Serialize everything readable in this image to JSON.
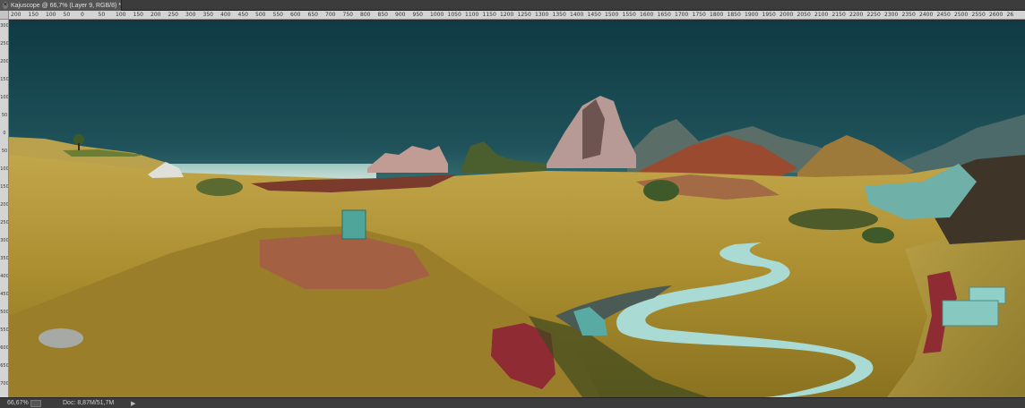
{
  "document": {
    "tab_title": "Kajuscope @ 66,7% (Layer 9, RGB/8) *",
    "close_label": "×"
  },
  "ruler": {
    "horizontal_ticks": [
      "200",
      "150",
      "100",
      "50",
      "0",
      "50",
      "100",
      "150",
      "200",
      "250",
      "300",
      "350",
      "400",
      "450",
      "500",
      "550",
      "600",
      "650",
      "700",
      "750",
      "800",
      "850",
      "900",
      "950",
      "1000",
      "1050",
      "1100",
      "1150",
      "1200",
      "1250",
      "1300",
      "1350",
      "1400",
      "1450",
      "1500",
      "1550",
      "1600",
      "1650",
      "1700",
      "1750",
      "1800",
      "1850",
      "1900",
      "1950",
      "2000",
      "2050",
      "2100",
      "2150",
      "2200",
      "2250",
      "2300",
      "2350",
      "2400",
      "2450",
      "2500",
      "2550",
      "2600",
      "26"
    ],
    "vertical_ticks": [
      "300",
      "250",
      "200",
      "150",
      "100",
      "50",
      "0",
      "50",
      "100",
      "150",
      "200",
      "250",
      "300",
      "350",
      "400",
      "450",
      "500",
      "550",
      "600",
      "650",
      "700"
    ]
  },
  "status": {
    "zoom": "66,67%",
    "doc_size": "Doc: 8,87M/51,7M",
    "arrow": "▶"
  },
  "colors": {
    "sky_top": "#113f47",
    "sky_horizon": "#2f6466",
    "grass_light": "#b99a3a",
    "grass_dark": "#7a6a22",
    "river": "#a8d8d2",
    "teal_objects": "#4fa59a",
    "red_rock": "#8e2b33"
  }
}
